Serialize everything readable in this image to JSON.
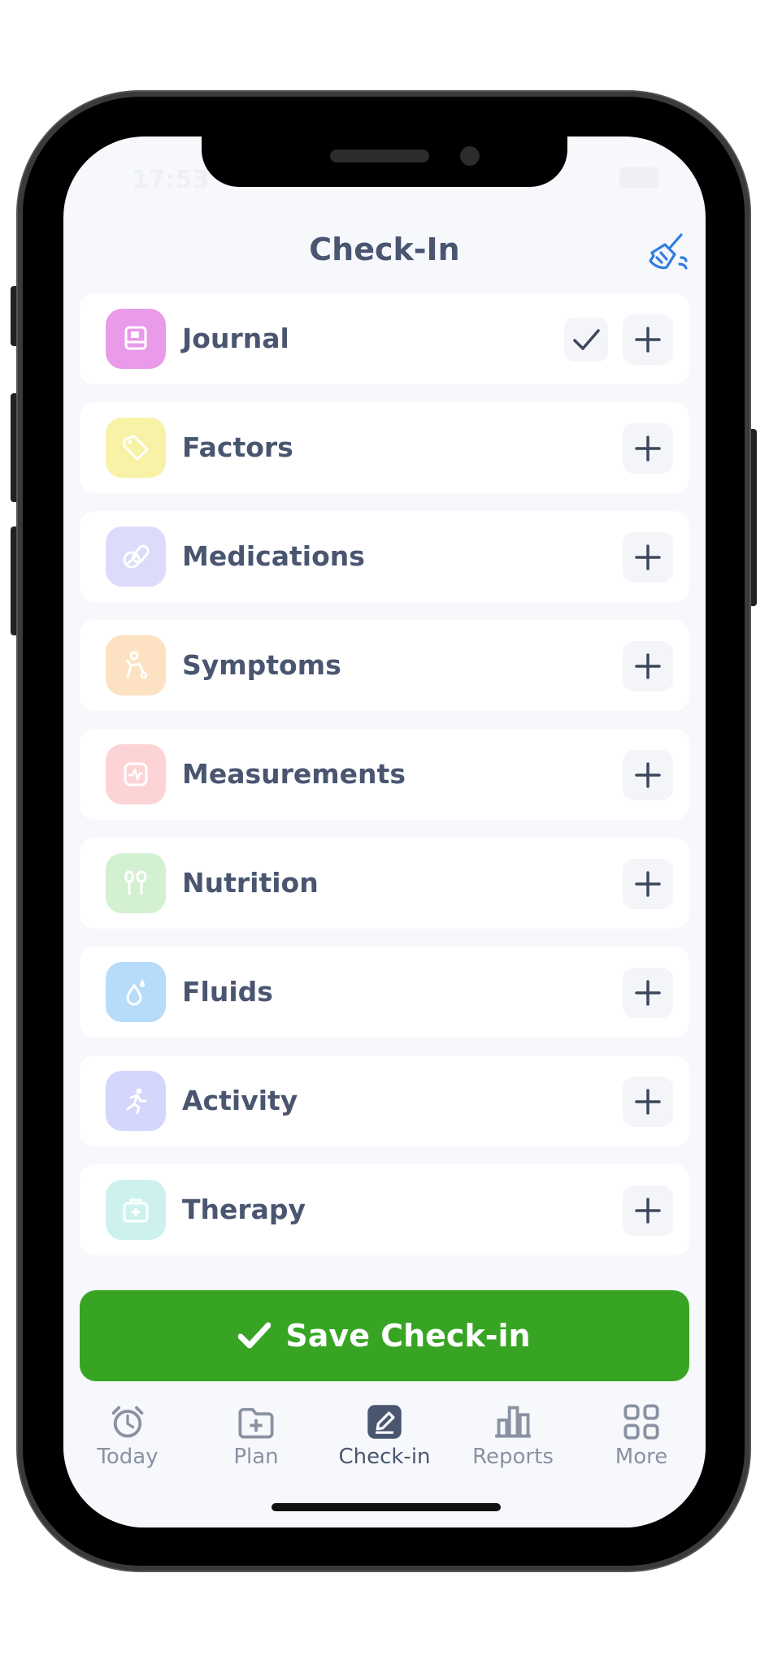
{
  "status_bar": {
    "time": "17:53"
  },
  "header": {
    "title": "Check-In",
    "clear_icon": "broom-icon"
  },
  "items": [
    {
      "label": "Journal",
      "icon": "journal-icon",
      "color": "#e99ae8",
      "checked": true
    },
    {
      "label": "Factors",
      "icon": "tag-icon",
      "color": "#f7f2a5",
      "checked": false
    },
    {
      "label": "Medications",
      "icon": "pill-icon",
      "color": "#dcdcfa",
      "checked": false
    },
    {
      "label": "Symptoms",
      "icon": "body-icon",
      "color": "#fce2c2",
      "checked": false
    },
    {
      "label": "Measurements",
      "icon": "pulse-icon",
      "color": "#fdd4d6",
      "checked": false
    },
    {
      "label": "Nutrition",
      "icon": "utensils-icon",
      "color": "#d4f0d2",
      "checked": false
    },
    {
      "label": "Fluids",
      "icon": "drop-icon",
      "color": "#b6dcfa",
      "checked": false
    },
    {
      "label": "Activity",
      "icon": "run-icon",
      "color": "#d4d6fb",
      "checked": false
    },
    {
      "label": "Therapy",
      "icon": "medkit-icon",
      "color": "#cdf2ed",
      "checked": false
    }
  ],
  "save_button": {
    "label": "Save Check-in",
    "color": "#38a424"
  },
  "tabs": [
    {
      "label": "Today",
      "icon": "alarm-clock-icon",
      "active": false
    },
    {
      "label": "Plan",
      "icon": "folder-plus-icon",
      "active": false
    },
    {
      "label": "Check-in",
      "icon": "edit-icon",
      "active": true
    },
    {
      "label": "Reports",
      "icon": "bar-chart-icon",
      "active": false
    },
    {
      "label": "More",
      "icon": "grid-icon",
      "active": false
    }
  ]
}
